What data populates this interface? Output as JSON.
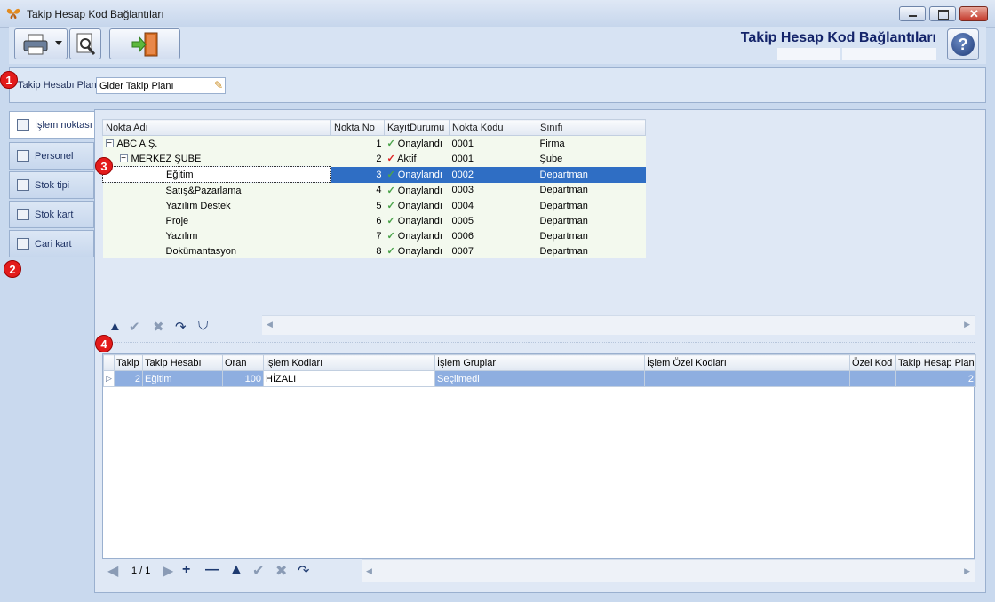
{
  "window": {
    "title": "Takip Hesap Kod Bağlantıları"
  },
  "header": {
    "title": "Takip Hesap Kod Bağlantıları"
  },
  "plan": {
    "label": "Takip Hesabı Planı",
    "value": "Gider Takip Planı"
  },
  "badges": [
    "1",
    "2",
    "3",
    "4"
  ],
  "sidetabs": [
    {
      "label": "İşlem noktası",
      "icon": "tree-icon"
    },
    {
      "label": "Personel",
      "icon": "person-card-icon"
    },
    {
      "label": "Stok tipi",
      "icon": "barcode-icon"
    },
    {
      "label": "Stok kart",
      "icon": "tag-icon"
    },
    {
      "label": "Cari kart",
      "icon": "cards-icon"
    }
  ],
  "tree": {
    "columns": [
      "Nokta Adı",
      "Nokta No",
      "KayıtDurumu",
      "Nokta Kodu",
      "Sınıfı"
    ],
    "rows": [
      {
        "name": "ABC A.Ş.",
        "no": "1",
        "status": "Onaylandı",
        "code": "0001",
        "class": "Firma",
        "level": 0,
        "expander": "−",
        "statusIcon": "check"
      },
      {
        "name": "MERKEZ ŞUBE",
        "no": "2",
        "status": "Aktif",
        "code": "0001",
        "class": "Şube",
        "level": 1,
        "expander": "−",
        "statusIcon": "check-red"
      },
      {
        "name": "Eğitim",
        "no": "3",
        "status": "Onaylandı",
        "code": "0002",
        "class": "Departman",
        "level": 2,
        "selected": true,
        "statusIcon": "check"
      },
      {
        "name": "Satış&Pazarlama",
        "no": "4",
        "status": "Onaylandı",
        "code": "0003",
        "class": "Departman",
        "level": 2,
        "statusIcon": "check"
      },
      {
        "name": "Yazılım Destek",
        "no": "5",
        "status": "Onaylandı",
        "code": "0004",
        "class": "Departman",
        "level": 2,
        "statusIcon": "check"
      },
      {
        "name": "Proje",
        "no": "6",
        "status": "Onaylandı",
        "code": "0005",
        "class": "Departman",
        "level": 2,
        "statusIcon": "check"
      },
      {
        "name": "Yazılım",
        "no": "7",
        "status": "Onaylandı",
        "code": "0006",
        "class": "Departman",
        "level": 2,
        "statusIcon": "check"
      },
      {
        "name": "Dokümantasyon",
        "no": "8",
        "status": "Onaylandı",
        "code": "0007",
        "class": "Departman",
        "level": 2,
        "statusIcon": "check"
      }
    ]
  },
  "grid": {
    "columns": [
      "Takip",
      "Takip Hesabı",
      "Oran",
      "İşlem Kodları",
      "İşlem Grupları",
      "İşlem Özel Kodları",
      "Özel Kod",
      "Takip Hesap Plan I"
    ],
    "rows": [
      {
        "takip": "2",
        "hesap": "Eğitim",
        "oran": "100",
        "kodlar": "HİZALI",
        "gruplar": "Seçilmedi",
        "ozelKodlar": "",
        "ozelKod": "",
        "plan": "2"
      }
    ]
  },
  "pager": {
    "text": "1 / 1"
  }
}
